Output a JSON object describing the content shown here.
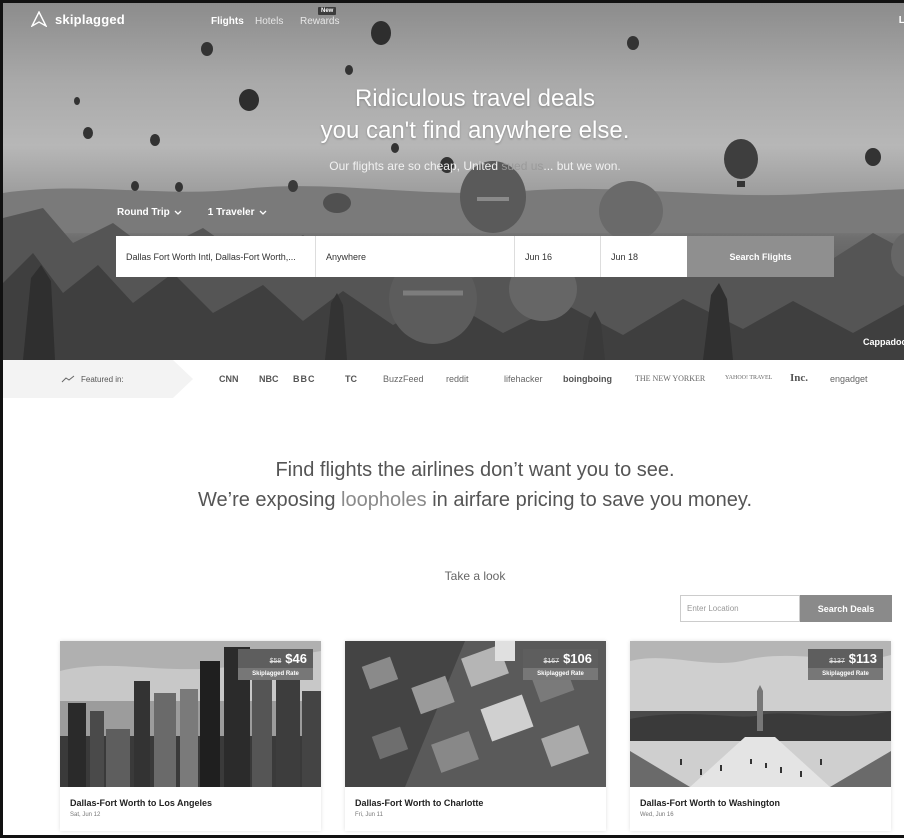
{
  "brand": {
    "name": "skiplagged"
  },
  "nav": {
    "items": [
      {
        "label": "Flights",
        "active": true
      },
      {
        "label": "Hotels",
        "active": false
      },
      {
        "label": "Rewards",
        "active": false
      }
    ],
    "new_badge": "New",
    "login_label": "Lo"
  },
  "hero": {
    "headline_line1": "Ridiculous travel deals",
    "headline_line2": "you can't find anywhere else.",
    "tagline_before": "Our flights are so cheap, United ",
    "tagline_sued": "sued us",
    "tagline_after": "... but we won.",
    "trip_type": "Round Trip",
    "travelers": "1 Traveler",
    "location_caption": "Cappadoci"
  },
  "search": {
    "from": "Dallas Fort Worth Intl, Dallas-Fort Worth,...",
    "to": "Anywhere",
    "depart": "Jun 16",
    "return": "Jun 18",
    "button": "Search Flights"
  },
  "featured": {
    "label": "Featured in:",
    "outlets": [
      "CNN",
      "NBC",
      "BBC",
      "TC",
      "BuzzFeed",
      "reddit",
      "lifehacker",
      "boingboing",
      "THE NEW YORKER",
      "YAHOO! TRAVEL",
      "Inc.",
      "engadget"
    ]
  },
  "pitch": {
    "line1": "Find flights the airlines don’t want you to see.",
    "line2_before": "We’re exposing ",
    "line2_link": "loopholes",
    "line2_after": " in airfare pricing to save you money."
  },
  "deals": {
    "take_look": "Take a look",
    "location_placeholder": "Enter Location",
    "search_button": "Search Deals",
    "rate_label": "Skiplagged Rate",
    "cards": [
      {
        "old_price": "$58",
        "price": "$46",
        "route": "Dallas-Fort Worth to Los Angeles",
        "date": "Sat, Jun 12"
      },
      {
        "old_price": "$167",
        "price": "$106",
        "route": "Dallas-Fort Worth to Charlotte",
        "date": "Fri, Jun 11"
      },
      {
        "old_price": "$137",
        "price": "$113",
        "route": "Dallas-Fort Worth to Washington",
        "date": "Wed, Jun 16"
      }
    ]
  }
}
